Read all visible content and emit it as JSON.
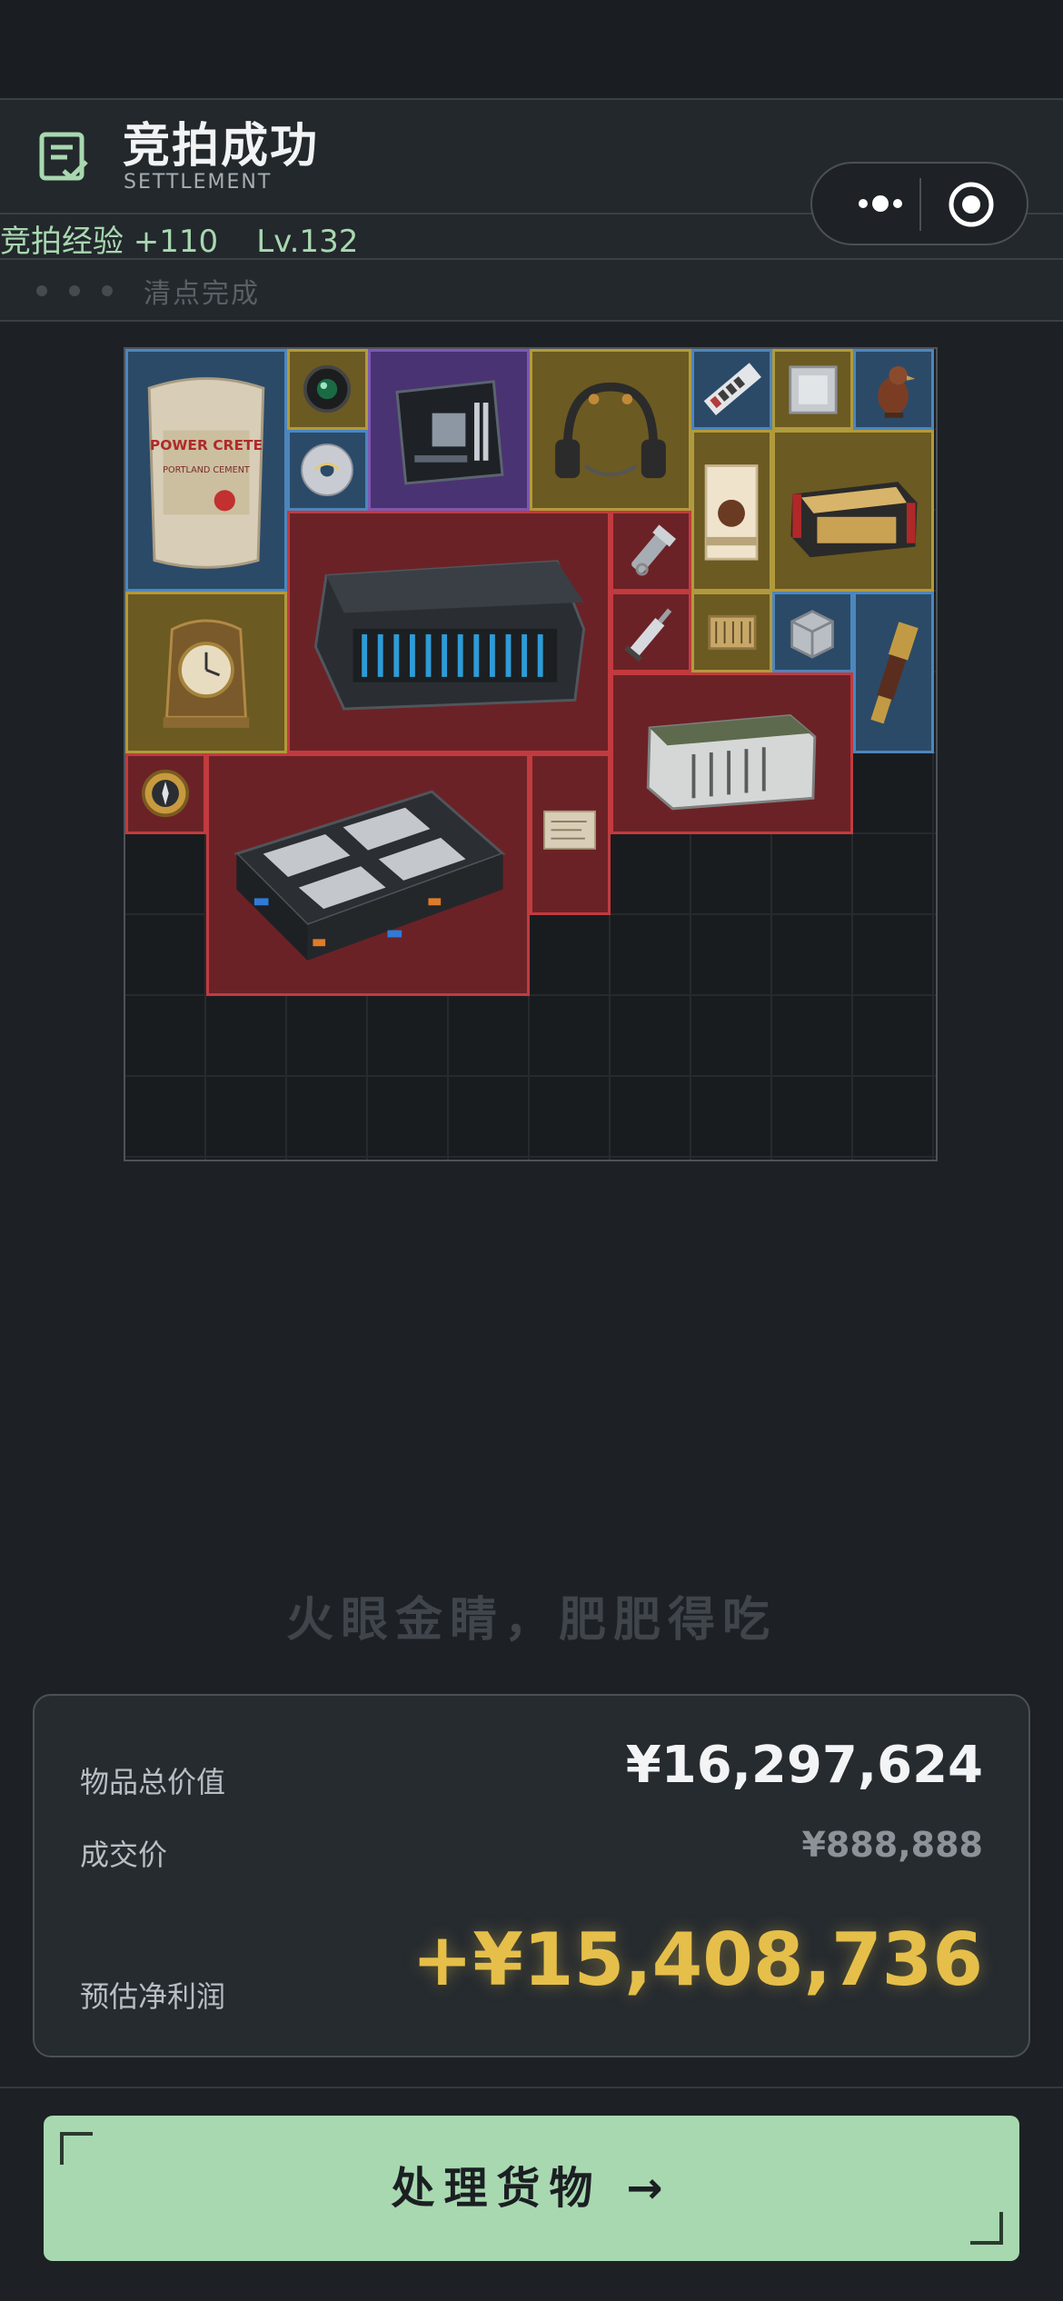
{
  "header": {
    "title": "竞拍成功",
    "subtitle": "SETTLEMENT",
    "icon": "document-check-icon",
    "accent_color": "#a8d8b0"
  },
  "status": {
    "exp_text": "竞拍经验 +110",
    "level_text": "Lv.132",
    "progress_text": "清点完成"
  },
  "capsule": {
    "more_icon": "more-dots-icon",
    "close_icon": "target-close-icon"
  },
  "grid": {
    "columns": 10,
    "rows": 10,
    "items": [
      {
        "name": "cement-bag",
        "rarity": "blue",
        "label": "POWER CRETE",
        "sublabel": "PORTLAND CEMENT"
      },
      {
        "name": "camera-lens",
        "rarity": "yellow"
      },
      {
        "name": "motherboard",
        "rarity": "purple"
      },
      {
        "name": "headset",
        "rarity": "yellow"
      },
      {
        "name": "ram-stick",
        "rarity": "blue"
      },
      {
        "name": "cpu-chip",
        "rarity": "yellow"
      },
      {
        "name": "bird-figurine",
        "rarity": "blue"
      },
      {
        "name": "cd-disc",
        "rarity": "blue"
      },
      {
        "name": "server-case",
        "rarity": "red"
      },
      {
        "name": "flashlight",
        "rarity": "red"
      },
      {
        "name": "coffee-box",
        "rarity": "yellow"
      },
      {
        "name": "ammo-crate",
        "rarity": "yellow"
      },
      {
        "name": "mantel-clock",
        "rarity": "yellow"
      },
      {
        "name": "syringe",
        "rarity": "red"
      },
      {
        "name": "circuit-chip",
        "rarity": "yellow"
      },
      {
        "name": "metal-cube",
        "rarity": "blue"
      },
      {
        "name": "telescope",
        "rarity": "blue"
      },
      {
        "name": "military-crate",
        "rarity": "red"
      },
      {
        "name": "compass",
        "rarity": "red"
      },
      {
        "name": "gpu-rack",
        "rarity": "red"
      },
      {
        "name": "old-document",
        "rarity": "red"
      }
    ]
  },
  "slogan": "火眼金睛，肥肥得吃",
  "summary": {
    "total_label": "物品总价值",
    "total_value": "¥16,297,624",
    "deal_label": "成交价",
    "deal_value": "¥888,888",
    "profit_label": "预估净利润",
    "profit_value": "+¥15,408,736",
    "profit_color": "#e5bf49"
  },
  "cta": {
    "label": "处理货物 →",
    "color": "#a8d8b0"
  }
}
